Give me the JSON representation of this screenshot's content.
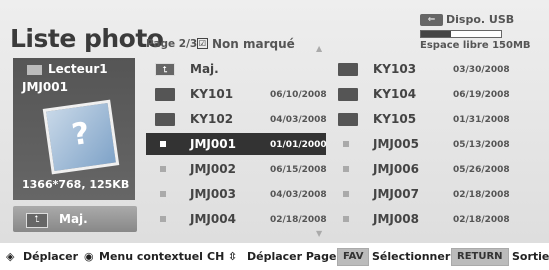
{
  "header": {
    "title": "Liste photo",
    "page_info": "Page 2/3",
    "check_glyph": "☑",
    "unmarked_label": "Non marqué"
  },
  "usb": {
    "icon": "usb-icon",
    "label": "Dispo. USB",
    "free_space": "Espace libre 150MB",
    "usage_fraction": 0.38
  },
  "preview": {
    "device_name": "Lecteur1",
    "file_name": "JMJ001",
    "placeholder": "?",
    "resolution": "1366*768, 125KB",
    "up_button_label": "Maj."
  },
  "files": {
    "left": [
      {
        "type": "up",
        "name": "Maj.",
        "date": ""
      },
      {
        "type": "folder",
        "name": "KY101",
        "date": "06/10/2008"
      },
      {
        "type": "folder",
        "name": "KY102",
        "date": "04/03/2008"
      },
      {
        "type": "image",
        "name": "JMJ001",
        "date": "01/01/2000",
        "selected": true
      },
      {
        "type": "image",
        "name": "JMJ002",
        "date": "06/15/2008"
      },
      {
        "type": "image",
        "name": "JMJ003",
        "date": "04/03/2008"
      },
      {
        "type": "image",
        "name": "JMJ004",
        "date": "02/18/2008"
      }
    ],
    "right": [
      {
        "type": "folder",
        "name": "KY103",
        "date": "03/30/2008"
      },
      {
        "type": "folder",
        "name": "KY104",
        "date": "06/19/2008"
      },
      {
        "type": "folder",
        "name": "KY105",
        "date": "01/31/2008"
      },
      {
        "type": "image",
        "name": "JMJ005",
        "date": "05/13/2008"
      },
      {
        "type": "image",
        "name": "JMJ006",
        "date": "05/26/2008"
      },
      {
        "type": "image",
        "name": "JMJ007",
        "date": "02/18/2008"
      },
      {
        "type": "image",
        "name": "JMJ008",
        "date": "02/18/2008"
      }
    ]
  },
  "legend": {
    "move": "Déplacer",
    "context_menu": "Menu contextuel",
    "ch": "CH",
    "move_page": "Déplacer Page",
    "fav": "FAV",
    "select": "Sélectionner",
    "return": "RETURN",
    "exit": "Sortie"
  }
}
